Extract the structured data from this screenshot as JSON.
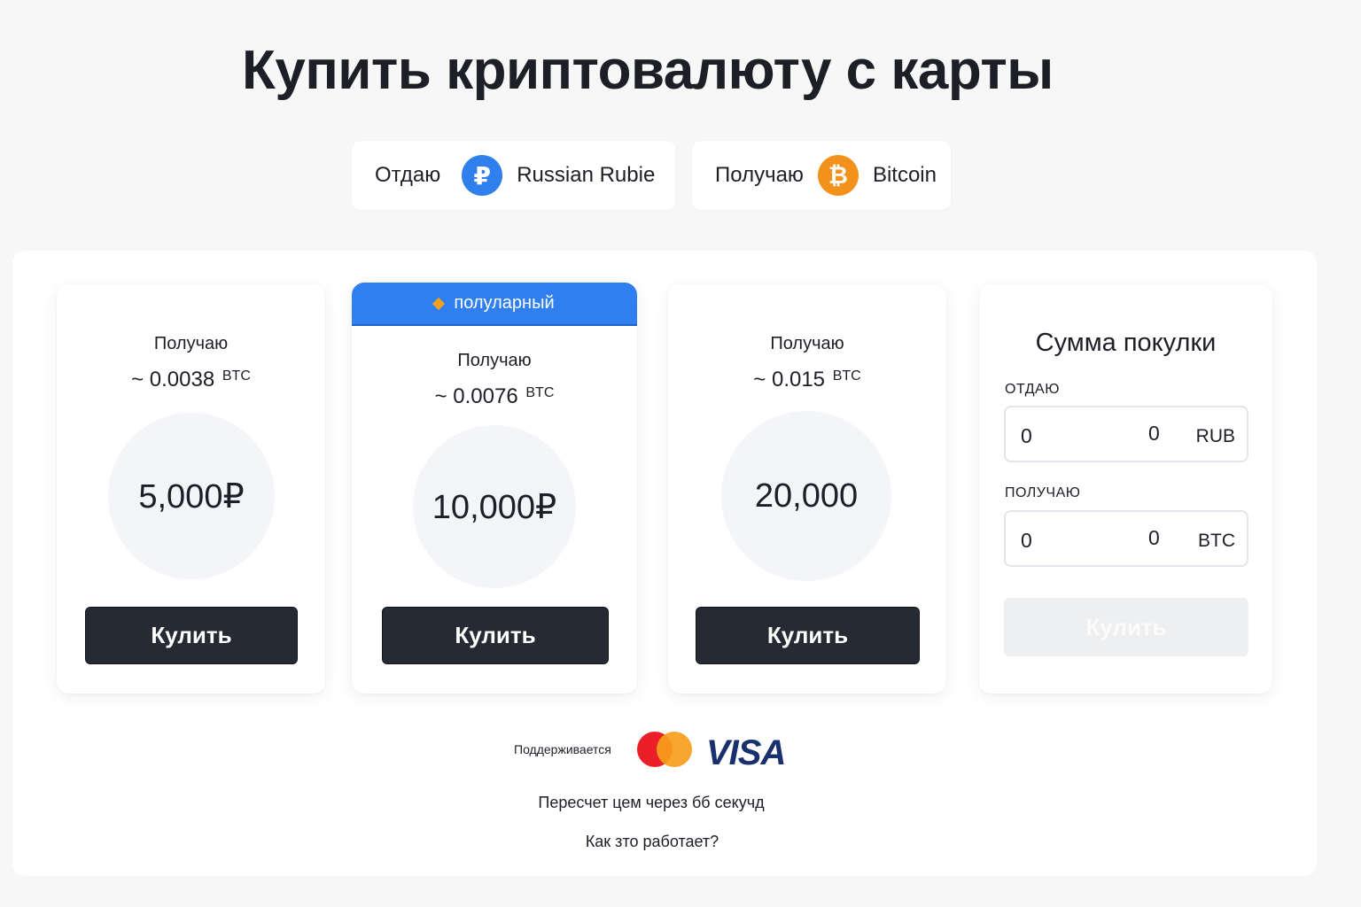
{
  "page": {
    "title": "Купить криптовалюту с карты"
  },
  "pair": {
    "give_label": "Отдаю",
    "give_currency": "Russian Rubie",
    "give_icon": "ruble-coin-icon",
    "give_icon_glyph": "₽",
    "give_color": "#2f80ed",
    "get_label": "Получаю",
    "get_currency": "Bitcoin",
    "get_icon": "bitcoin-coin-icon",
    "get_icon_glyph": "₿",
    "get_color": "#f2921b"
  },
  "offers": [
    {
      "get_label": "Получаю",
      "amount": "~ 0.0038",
      "unit": "BTC",
      "price": "5,000₽",
      "button": "Кулить"
    },
    {
      "badge": "полуларный",
      "get_label": "Получаю",
      "amount": "~ 0.0076",
      "unit": "BTC",
      "price": "10,000₽",
      "button": "Кулить"
    },
    {
      "get_label": "Получаю",
      "amount": "~ 0.015",
      "unit": "BTC",
      "price": "20,000",
      "button": "Кулить"
    }
  ],
  "custom": {
    "title": "Сумма покулки",
    "give_label": "ОТДАЮ",
    "give_value": "0",
    "give_value2": "0",
    "give_unit": "RUB",
    "get_label": "ПОЛУЧАЮ",
    "get_value": "0",
    "get_value2": "0",
    "get_unit": "BTC",
    "button": "Кулить"
  },
  "footer": {
    "supported_label": "Поддерживается",
    "visa": "VISA",
    "recalc": "Пересчет цем через бб секучд",
    "how_it_works": "Как зто работает?"
  },
  "colors": {
    "accent": "#2f7ff0",
    "button_dark": "#262a33",
    "badge_diamond": "#f4a21e"
  }
}
